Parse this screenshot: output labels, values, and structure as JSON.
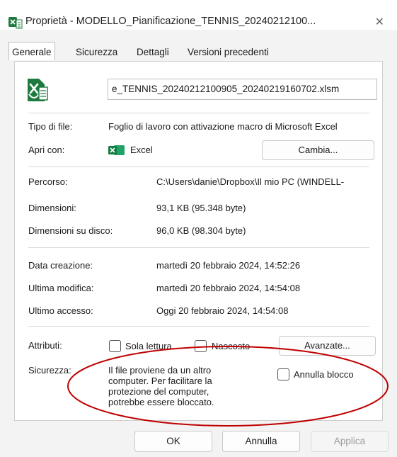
{
  "window": {
    "title": "Proprietà - MODELLO_Pianificazione_TENNIS_20240212100...",
    "close_symbol": "✕"
  },
  "tabs": [
    {
      "label": "Generale",
      "active": true
    },
    {
      "label": "Sicurezza",
      "active": false
    },
    {
      "label": "Dettagli",
      "active": false
    },
    {
      "label": "Versioni precedenti",
      "active": false
    }
  ],
  "file": {
    "name": "e_TENNIS_20240212100905_20240219160702.xlsm",
    "type_label": "Tipo di file:",
    "type_value": "Foglio di lavoro con attivazione macro di Microsoft Excel",
    "open_with_label": "Apri con:",
    "open_with_value": "Excel",
    "change_button": "Cambia..."
  },
  "location": {
    "path_label": "Percorso:",
    "path_value": "C:\\Users\\danie\\Dropbox\\Il mio PC (WINDELL-",
    "size_label": "Dimensioni:",
    "size_value": "93,1 KB (95.348 byte)",
    "disk_size_label": "Dimensioni su disco:",
    "disk_size_value": "96,0 KB (98.304 byte)"
  },
  "dates": {
    "created_label": "Data creazione:",
    "created_value": "martedì 20 febbraio 2024, 14:52:26",
    "modified_label": "Ultima modifica:",
    "modified_value": "martedì 20 febbraio 2024, 14:54:08",
    "accessed_label": "Ultimo accesso:",
    "accessed_value": "Oggi 20 febbraio 2024, 14:54:08"
  },
  "attributes": {
    "label": "Attributi:",
    "readonly_label": "Sola lettura",
    "readonly_checked": false,
    "hidden_label": "Nascosto",
    "hidden_checked": false,
    "advanced_button": "Avanzate..."
  },
  "security": {
    "label": "Sicurezza:",
    "message_lines": [
      "Il file proviene da un altro",
      "computer. Per facilitare la",
      "protezione del computer,",
      "potrebbe essere bloccato."
    ],
    "unblock_label": "Annulla blocco",
    "unblock_checked": false,
    "highlight_color": "#c00000"
  },
  "footer": {
    "ok_button": "OK",
    "cancel_button": "Annulla",
    "apply_button": "Applica"
  },
  "icons": {
    "title_icon": "excel-macro-file-icon",
    "file_icon": "excel-macro-file-icon",
    "app_icon": "excel-icon"
  },
  "colors": {
    "excel_green": "#1f7a3f",
    "window_bg": "#f3f3f3"
  }
}
